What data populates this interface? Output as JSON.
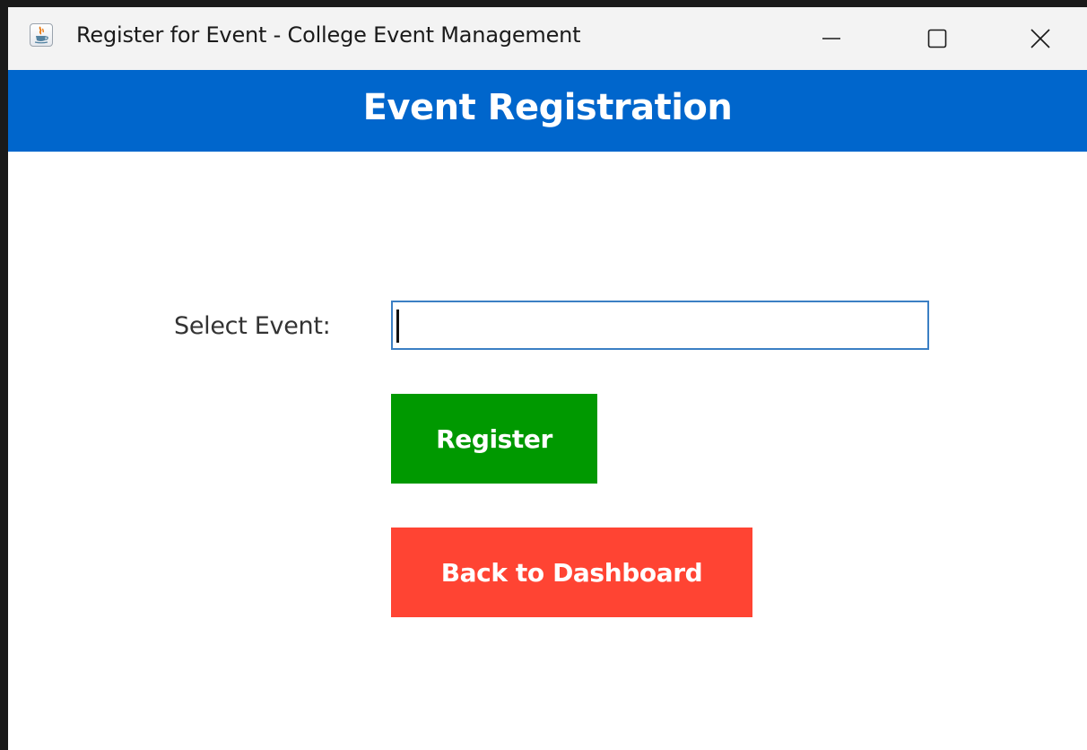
{
  "window": {
    "title": "Register for Event - College Event Management",
    "app_icon": "java-coffee-cup-icon",
    "controls": {
      "minimize_icon": "minimize-icon",
      "maximize_icon": "maximize-icon",
      "close_icon": "close-icon"
    }
  },
  "header": {
    "title": "Event Registration",
    "background": "#0066cc",
    "text_color": "#ffffff"
  },
  "form": {
    "event_label": "Select Event:",
    "event_value": "",
    "register_label": "Register",
    "register_color": "#009900",
    "back_label": "Back to Dashboard",
    "back_color": "#ff4433"
  }
}
